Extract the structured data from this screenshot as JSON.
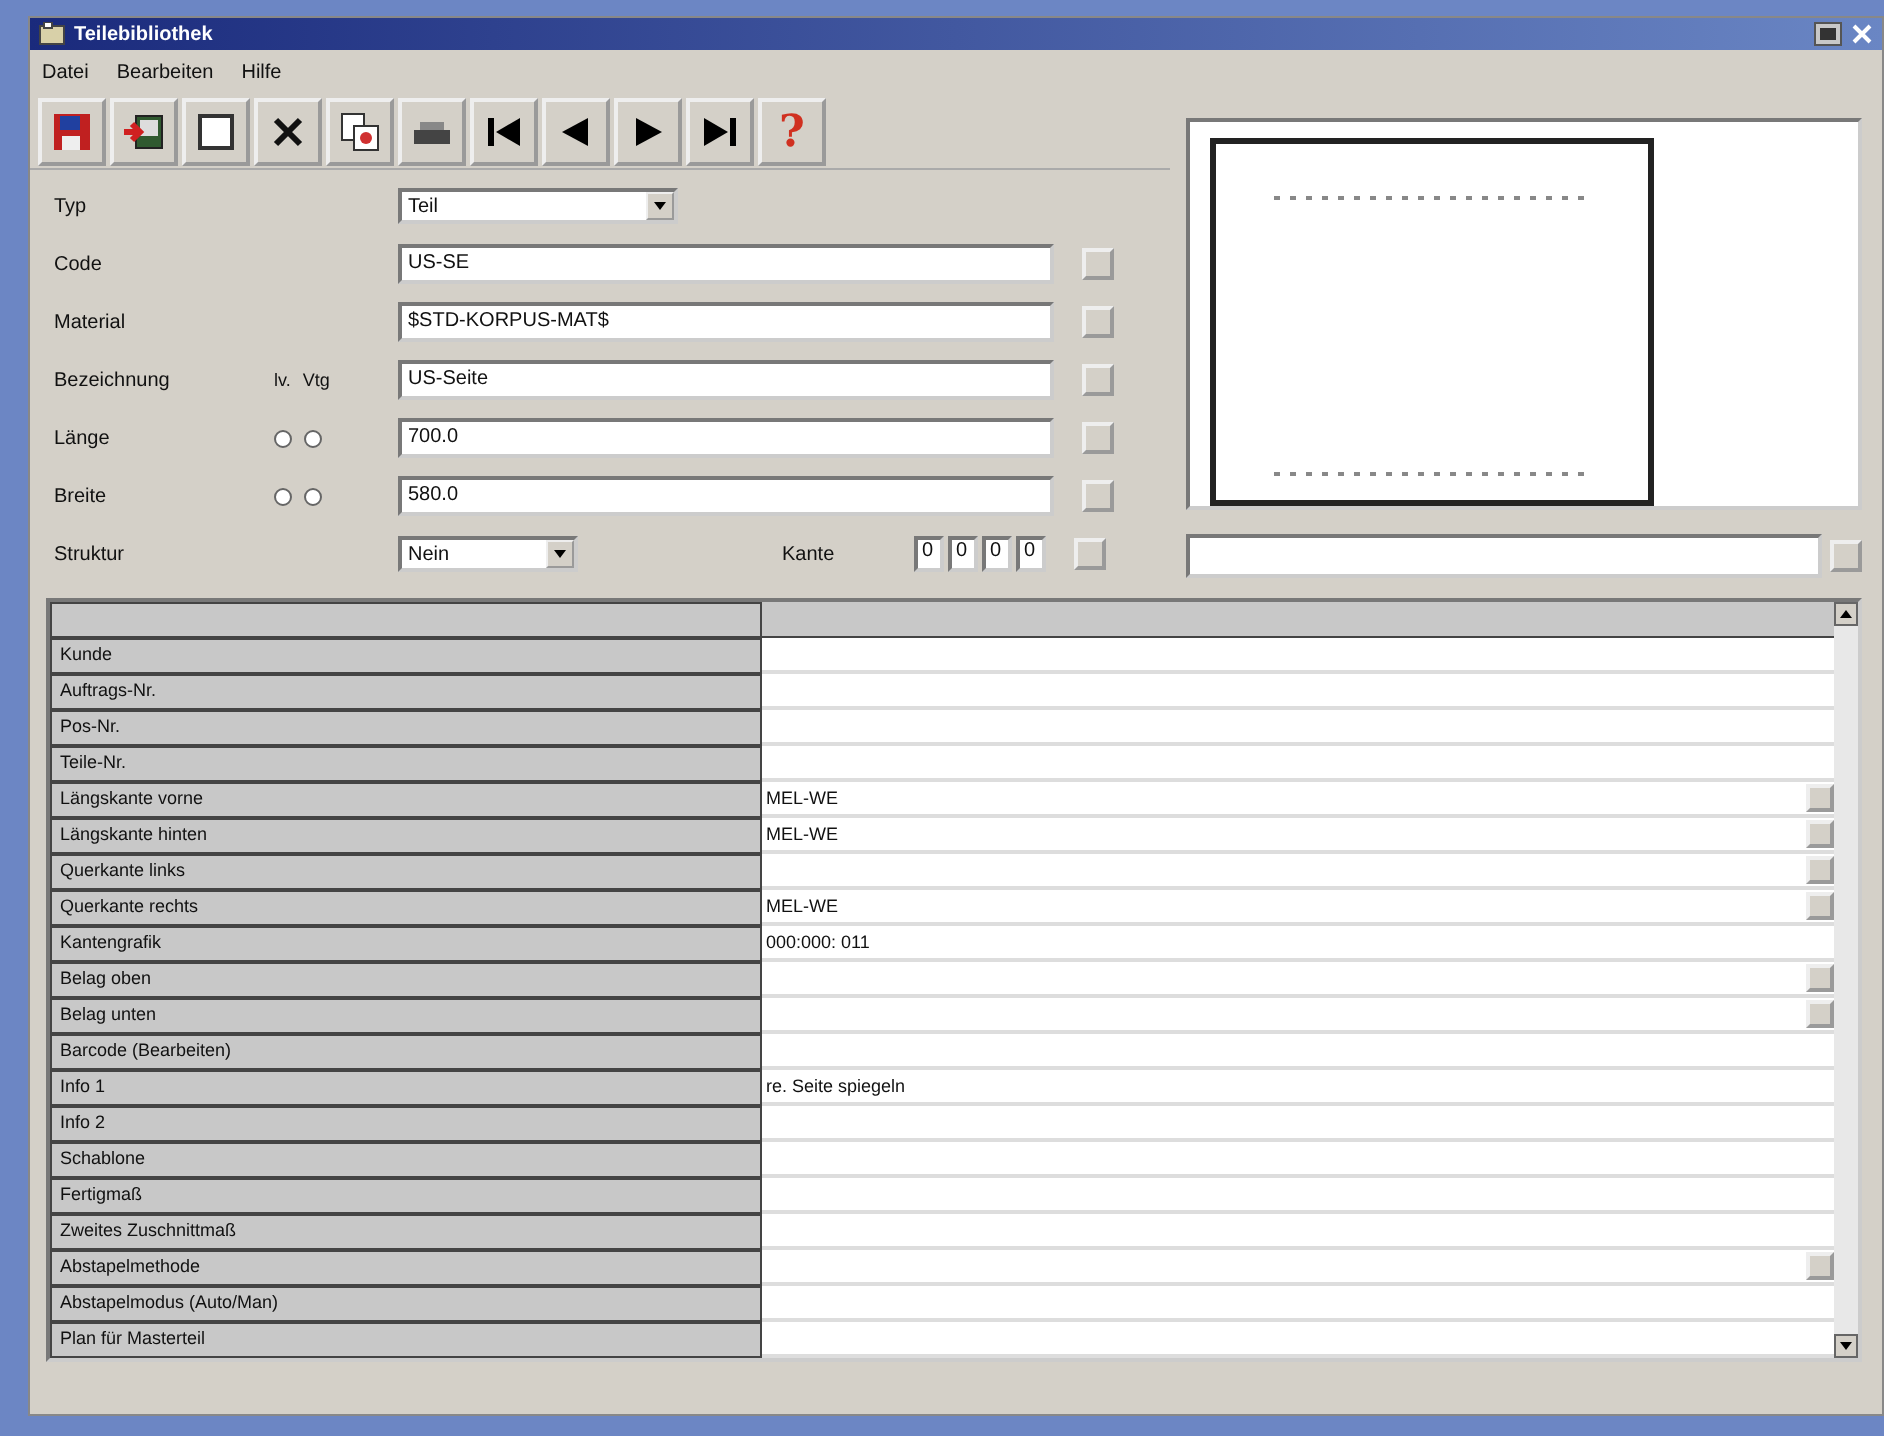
{
  "window": {
    "title": "Teilebibliothek"
  },
  "menu": [
    "Datei",
    "Bearbeiten",
    "Hilfe"
  ],
  "toolbar": [
    {
      "kind": "save"
    },
    {
      "kind": "import"
    },
    {
      "kind": "new"
    },
    {
      "kind": "delete"
    },
    {
      "kind": "copy"
    },
    {
      "kind": "print"
    },
    {
      "kind": "first"
    },
    {
      "kind": "prev"
    },
    {
      "kind": "next"
    },
    {
      "kind": "last"
    },
    {
      "kind": "help",
      "glyph": "?"
    }
  ],
  "form": {
    "radio_headers": [
      "lv.",
      "Vtg"
    ],
    "fields": [
      {
        "kind": "select",
        "label": "Typ",
        "value": "Teil"
      },
      {
        "kind": "text",
        "label": "Code",
        "value": "US-SE"
      },
      {
        "kind": "text",
        "label": "Material",
        "value": "$STD-KORPUS-MAT$"
      },
      {
        "kind": "text",
        "label": "Bezeichnung",
        "value": "US-Seite"
      },
      {
        "kind": "text",
        "label": "Länge",
        "value": "700.0",
        "radios": [
          {
            "selected": false
          },
          {
            "selected": false
          }
        ]
      },
      {
        "kind": "text",
        "label": "Breite",
        "value": "580.0",
        "radios": [
          {
            "selected": false
          },
          {
            "selected": false
          }
        ]
      }
    ],
    "struktur": {
      "label": "Struktur",
      "value": "Nein"
    },
    "kante": {
      "label": "Kante",
      "values": [
        "0",
        "0",
        "0",
        "0"
      ]
    }
  },
  "grid": {
    "rows": [
      {
        "label": "Kunde",
        "value": "",
        "kind": "text"
      },
      {
        "label": "Auftrags-Nr.",
        "value": "",
        "kind": "text"
      },
      {
        "label": "Pos-Nr.",
        "value": "",
        "kind": "text"
      },
      {
        "label": "Teile-Nr.",
        "value": "",
        "kind": "text"
      },
      {
        "label": "Längskante vorne",
        "value": "MEL-WE",
        "kind": "button"
      },
      {
        "label": "Längskante hinten",
        "value": "MEL-WE",
        "kind": "button"
      },
      {
        "label": "Querkante links",
        "value": "",
        "kind": "button"
      },
      {
        "label": "Querkante rechts",
        "value": "MEL-WE",
        "kind": "button"
      },
      {
        "label": "Kantengrafik",
        "value": "000:000: 011",
        "kind": "text"
      },
      {
        "label": "Belag oben",
        "value": "",
        "kind": "button"
      },
      {
        "label": "Belag unten",
        "value": "",
        "kind": "button"
      },
      {
        "label": "Barcode (Bearbeiten)",
        "value": "",
        "kind": "text"
      },
      {
        "label": "Info 1",
        "value": "re. Seite spiegeln",
        "kind": "text"
      },
      {
        "label": "Info 2",
        "value": "",
        "kind": "text"
      },
      {
        "label": "Schablone",
        "value": "",
        "kind": "text"
      },
      {
        "label": "Fertigmaß",
        "value": "",
        "kind": "text"
      },
      {
        "label": "Zweites Zuschnittmaß",
        "value": "",
        "kind": "text"
      },
      {
        "label": "Abstapelmethode",
        "value": "",
        "kind": "button"
      },
      {
        "label": "Abstapelmodus (Auto/Man)",
        "value": "",
        "kind": "text"
      },
      {
        "label": "Plan für Masterteil",
        "value": "",
        "kind": "text"
      }
    ]
  }
}
